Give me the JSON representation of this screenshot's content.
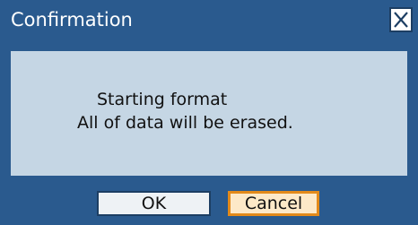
{
  "dialog": {
    "title": "Confirmation",
    "close_icon": "close-x-icon",
    "message_lines": [
      "Starting format",
      "All of data will be erased."
    ],
    "buttons": {
      "ok_label": "OK",
      "cancel_label": "Cancel"
    },
    "colors": {
      "titlebar": "#2a5a8e",
      "panel": "#c5d6e4",
      "focused_button_border": "#e38a1a"
    },
    "focused_button": "Cancel"
  }
}
